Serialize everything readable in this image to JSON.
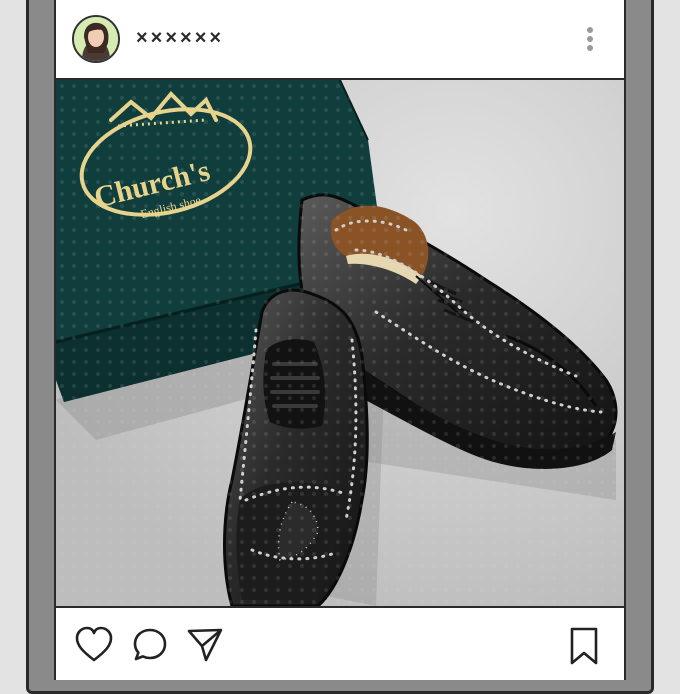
{
  "post": {
    "username": "××××××",
    "more_icon": "more-vertical-icon"
  },
  "image": {
    "box_brand": "Church's",
    "box_subtitle": "English shoe",
    "box_color": "#0f3e3d",
    "logo_color": "#e8d38c"
  },
  "actions": {
    "like_icon": "heart-icon",
    "comment_icon": "comment-icon",
    "share_icon": "send-icon",
    "save_icon": "bookmark-icon"
  }
}
